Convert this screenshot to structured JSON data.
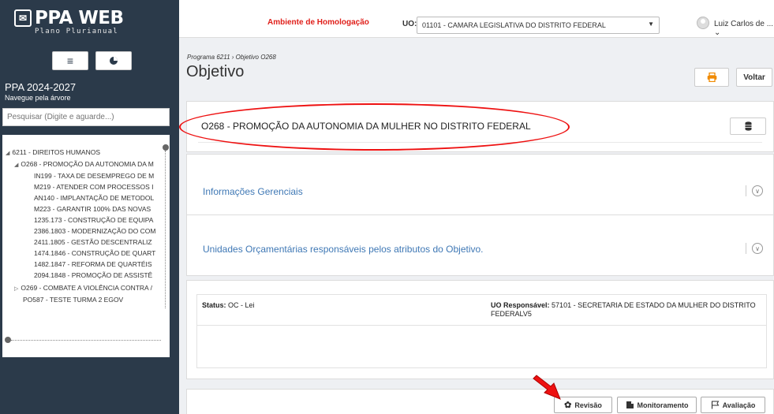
{
  "brand": {
    "name": "PPA WEB",
    "subtitle": "Plano Plurianual"
  },
  "sidebar": {
    "ppa_title": "PPA 2024-2027",
    "ppa_sub": "Navegue pela árvore",
    "search_placeholder": "Pesquisar (Digite e aguarde...)",
    "tree": [
      {
        "label": "6211 - DIREITOS HUMANOS",
        "arrow": "◢"
      },
      {
        "label": "O268 - PROMOÇÃO DA AUTONOMIA DA M",
        "arrow": "◢"
      },
      {
        "label": "IN199 - TAXA DE DESEMPREGO DE M",
        "arrow": ""
      },
      {
        "label": "M219 - ATENDER COM PROCESSOS I",
        "arrow": ""
      },
      {
        "label": "AN140 - IMPLANTAÇÃO DE METODOL",
        "arrow": ""
      },
      {
        "label": "M223 - GARANTIR 100% DAS NOVAS",
        "arrow": ""
      },
      {
        "label": "1235.173 - CONSTRUÇÃO DE EQUIPA",
        "arrow": ""
      },
      {
        "label": "2386.1803 - MODERNIZAÇÃO DO COM",
        "arrow": ""
      },
      {
        "label": "2411.1805 - GESTÃO DESCENTRALIZ",
        "arrow": ""
      },
      {
        "label": "1474.1846 - CONSTRUÇÃO DE QUART",
        "arrow": ""
      },
      {
        "label": "1482.1847 - REFORMA DE QUARTÉIS",
        "arrow": ""
      },
      {
        "label": "2094.1848 - PROMOÇÃO DE ASSISTÊ",
        "arrow": ""
      },
      {
        "label": "O269 - COMBATE A VIOLÊNCIA CONTRA /",
        "arrow": "▷"
      },
      {
        "label": "PO587 - TESTE TURMA 2 EGOV",
        "arrow": ""
      }
    ]
  },
  "topbar": {
    "environment": "Ambiente de Homologação",
    "uo_label": "UO:",
    "uo_value": "01101 - CAMARA LEGISLATIVA DO DISTRITO FEDERAL",
    "user": "Luiz Carlos de ..."
  },
  "header": {
    "breadcrumb": "Programa 6211 › Objetivo O268",
    "title": "Objetivo",
    "back_label": "Voltar"
  },
  "objective": {
    "code": "O268",
    "name": "PROMOÇÃO DA AUTONOMIA DA MULHER NO DISTRITO FEDERAL"
  },
  "sections": {
    "info": "Informações Gerenciais",
    "units": "Unidades Orçamentárias responsáveis pelos atributos do Objetivo."
  },
  "status": {
    "status_label": "Status:",
    "status_value": "OC - Lei",
    "uo_resp_label": "UO Responsável:",
    "uo_resp_value": "57101 - SECRETARIA DE ESTADO DA MULHER DO DISTRITO FEDERALV5"
  },
  "actions": {
    "revisao": "Revisão",
    "monitoramento": "Monitoramento",
    "avaliacao": "Avaliação"
  },
  "colors": {
    "sidebar": "#2b3a4a",
    "accent_link": "#3f78b5",
    "env_red": "#e0201b",
    "print_orange": "#f08a00"
  }
}
